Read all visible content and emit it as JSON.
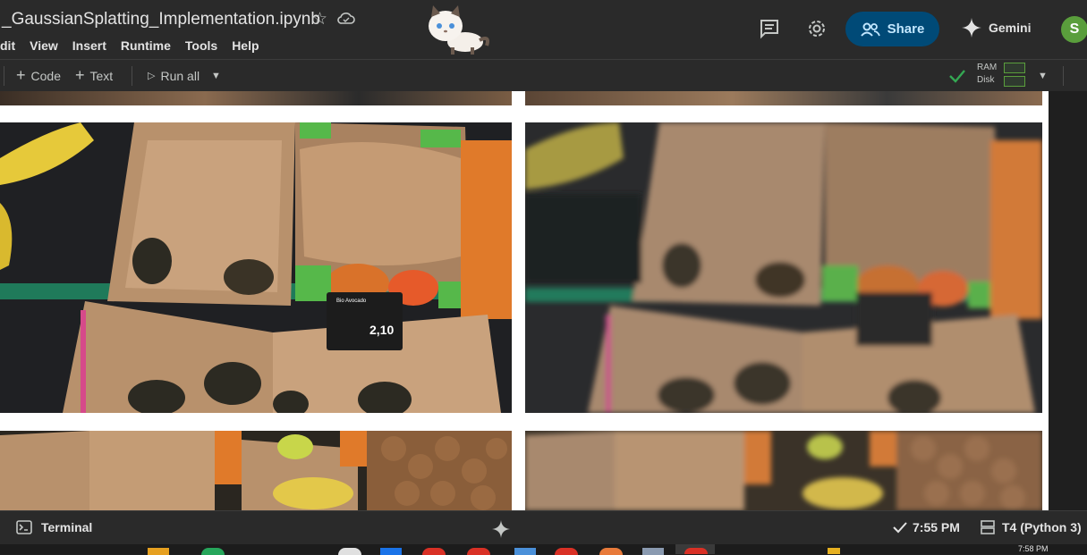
{
  "header": {
    "notebook_title": "_GaussianSplatting_Implementation.ipynb",
    "menu": [
      "dit",
      "View",
      "Insert",
      "Runtime",
      "Tools",
      "Help"
    ],
    "share_label": "Share",
    "gemini_label": "Gemini",
    "avatar_initial": "S"
  },
  "toolbar": {
    "code_label": "Code",
    "text_label": "Text",
    "run_all_label": "Run all",
    "ram_label": "RAM",
    "disk_label": "Disk"
  },
  "content": {
    "price_tag_title": "Bio Avocado",
    "price_tag_price": "2,10"
  },
  "statusbar": {
    "terminal_label": "Terminal",
    "time": "7:55 PM",
    "runtime": "T4 (Python 3)"
  },
  "taskbar": {
    "clock": "7:58 PM"
  },
  "colors": {
    "share_bg": "#004a77",
    "share_text": "#c2e7ff",
    "status_ok": "#5a9e3c",
    "avatar": "#5a9e3c"
  }
}
